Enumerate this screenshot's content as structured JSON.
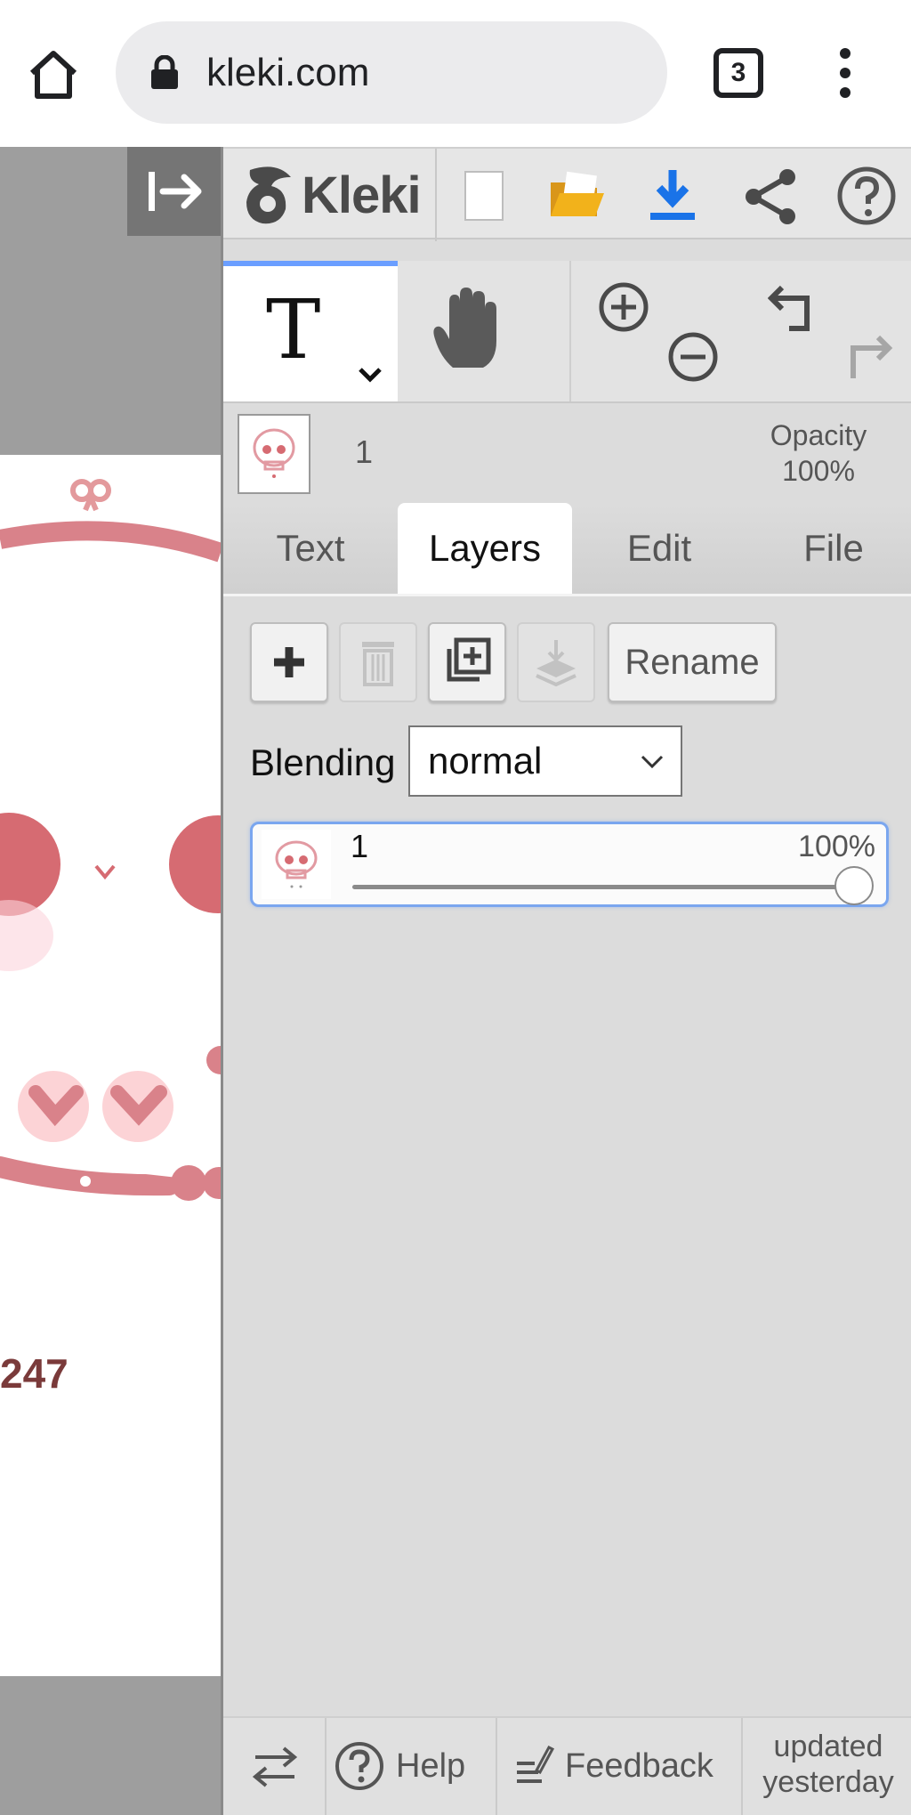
{
  "browser": {
    "url": "kleki.com",
    "tab_count": "3"
  },
  "app": {
    "logo_text": "Kleki"
  },
  "canvas": {
    "visible_number": "247"
  },
  "layer_info": {
    "active_layer_name": "1",
    "opacity_label": "Opacity",
    "opacity_value": "100%"
  },
  "tabs": [
    {
      "label": "Text"
    },
    {
      "label": "Layers"
    },
    {
      "label": "Edit"
    },
    {
      "label": "File"
    }
  ],
  "active_tab": "Layers",
  "layers_panel": {
    "rename_label": "Rename",
    "blending_label": "Blending",
    "blending_value": "normal",
    "layers": [
      {
        "name": "1",
        "opacity_text": "100%",
        "opacity": 1.0
      }
    ]
  },
  "footer": {
    "help_label": "Help",
    "feedback_label": "Feedback",
    "updated_line1": "updated",
    "updated_line2": "yesterday"
  },
  "colors": {
    "accent_blue": "#1a73e8",
    "folder_yellow": "#f2b21b",
    "active_tab_indicator": "#6a9eff",
    "canvas_pink": "#d9828a"
  }
}
